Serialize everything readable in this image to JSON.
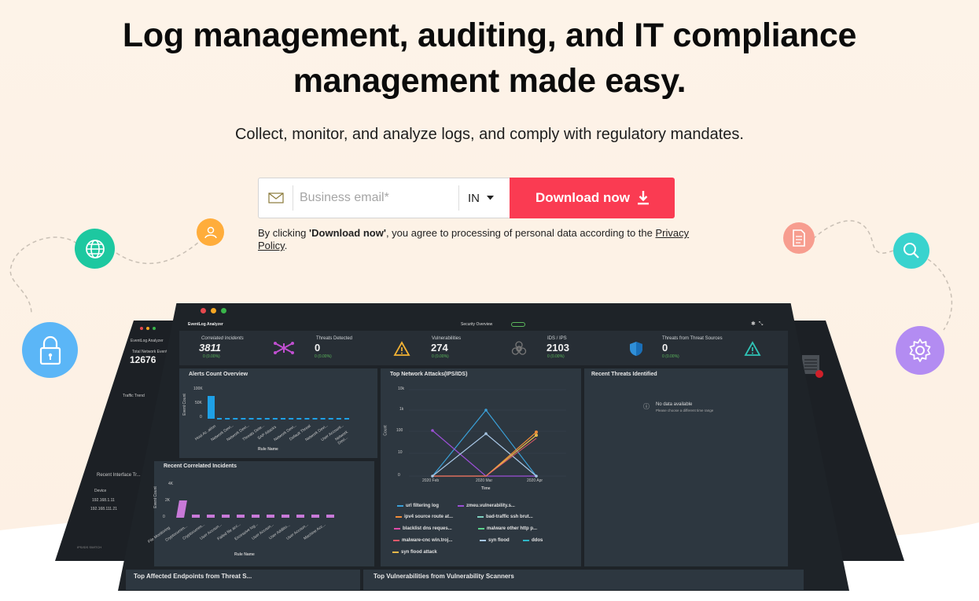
{
  "hero": {
    "title_line1": "Log management, auditing, and IT compliance",
    "title_line2": "management made easy.",
    "subtitle": "Collect, monitor, and analyze logs, and comply with regulatory mandates."
  },
  "form": {
    "email_placeholder": "Business email*",
    "country": "IN",
    "download_label": "Download now",
    "consent_prefix": "By clicking ",
    "consent_bold": "'Download now'",
    "consent_middle": ", you agree to processing of personal data according to the ",
    "consent_link": "Privacy Policy",
    "consent_end": "."
  },
  "icons": [
    "globe-icon",
    "user-icon",
    "lock-icon",
    "document-icon",
    "search-icon",
    "gear-icon"
  ],
  "colors": {
    "cta": "#fa3b52",
    "globe": "#1dc8a0",
    "user": "#ffad3b",
    "lock": "#5bb6f7",
    "doc": "#f79d8f",
    "search": "#39d3ce",
    "gear": "#b38cf2"
  },
  "dashboard": {
    "app_name": "EventLog Analyzer",
    "view": "Security Overview",
    "kpis": [
      {
        "label": "Correlated Incidents",
        "value": "3811",
        "delta": "0 (0.00%)"
      },
      {
        "label": "Threats Detected",
        "value": "0",
        "delta": "0 (0.00%)"
      },
      {
        "label": "Vulnerabilities",
        "value": "274",
        "delta": "0 (0.00%)"
      },
      {
        "label": "IDS / IPS",
        "value": "2103",
        "delta": "0 (0.00%)"
      },
      {
        "label": "Threats from Threat Sources",
        "value": "0",
        "delta": "0 (0.00%)"
      }
    ],
    "left_panel": {
      "label": "Total Network Events",
      "value": "12676",
      "traffic": "Traffic Trend",
      "recent": "Recent Interface Tr...",
      "device": "Device",
      "ip1": "192.168.1.11",
      "ip2": "192.168.111.21",
      "footer": "IPS/IDS SWITCH"
    },
    "panels": {
      "alerts": "Alerts Count Overview",
      "attacks": "Top Network Attacks(IPS/IDS)",
      "threats": "Recent Threats Identified",
      "correlated": "Recent Correlated Incidents",
      "endpoints": "Top Affected Endpoints from Threat S...",
      "vuln_scanners": "Top Vulnerabilities from Vulnerability Scanners",
      "no_data": "No data available",
      "no_data_hint": "Please choose a different time range"
    },
    "alerts_axis": {
      "ylabel": "Event Count",
      "xlabel": "Rule Name",
      "ticks": [
        "100K",
        "50K",
        "0"
      ],
      "cats": [
        "Host Ac..ation",
        "Network Devi...",
        "Network Devi...",
        "Threats Dete...",
        "SAP Attacks",
        "Network Devi...",
        "Default Threat",
        "Network Devi...",
        "User Account...",
        "Network Devi..."
      ]
    },
    "correlated_axis": {
      "ylabel": "Event Count",
      "xlabel": "Rule Name",
      "ticks": [
        "4K",
        "2K",
        "0"
      ],
      "cats": [
        "File Monitoring",
        "Cryptocurren...",
        "Cryptocurren...",
        "User Accoun...",
        "Failed file acc...",
        "Excessive log...",
        "User Accoun...",
        "User Additio...",
        "User Accoun...",
        "Machine Acc..."
      ]
    },
    "attacks_axis": {
      "ylabel": "Count",
      "xlabel": "Time",
      "ticks": [
        "10k",
        "1k",
        "100",
        "10",
        "0"
      ],
      "x": [
        "2020 Feb",
        "2020 Mar",
        "2020 Apr"
      ]
    },
    "attack_legend": [
      {
        "name": "url filtering log",
        "color": "#3aa0d8"
      },
      {
        "name": "zmeu.vulnerability.s...",
        "color": "#9b4fd6"
      },
      {
        "name": "ipv4 source route at...",
        "color": "#f08c3a"
      },
      {
        "name": "bad-traffic ssh brut...",
        "color": "#7ed0c0"
      },
      {
        "name": "blacklist dns reques...",
        "color": "#e04ba8"
      },
      {
        "name": "malware other http p...",
        "color": "#5ad28c"
      },
      {
        "name": "malware-cnc win.troj...",
        "color": "#e05a6a"
      },
      {
        "name": "syn flood",
        "color": "#a8c7e6"
      },
      {
        "name": "ddos",
        "color": "#2fb7c7"
      },
      {
        "name": "syn flood attack",
        "color": "#e8b84a"
      }
    ]
  }
}
